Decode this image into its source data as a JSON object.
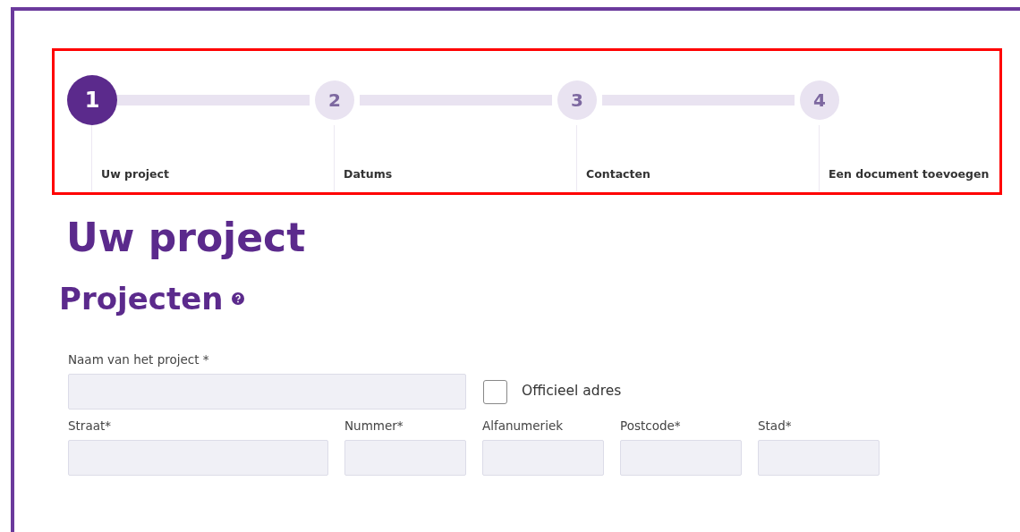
{
  "steps": [
    {
      "number": "1",
      "label": "Uw project",
      "selected": true
    },
    {
      "number": "2",
      "label": "Datums",
      "selected": false
    },
    {
      "number": "3",
      "label": "Contacten",
      "selected": false
    },
    {
      "number": "4",
      "label": "Een document toevoegen",
      "selected": false
    }
  ],
  "page_title": "Uw project",
  "section_title": "Projecten",
  "project_name": {
    "label": "Naam van het project *"
  },
  "official_address": {
    "label": "Officieel adres",
    "checked": false
  },
  "address_fields": [
    {
      "label": "Straat*",
      "kind": "wide"
    },
    {
      "label": "Nummer*",
      "kind": "narrow"
    },
    {
      "label": "Alfanumeriek",
      "kind": "narrow"
    },
    {
      "label": "Postcode*",
      "kind": "narrow"
    },
    {
      "label": "Stad*",
      "kind": "narrow"
    }
  ]
}
